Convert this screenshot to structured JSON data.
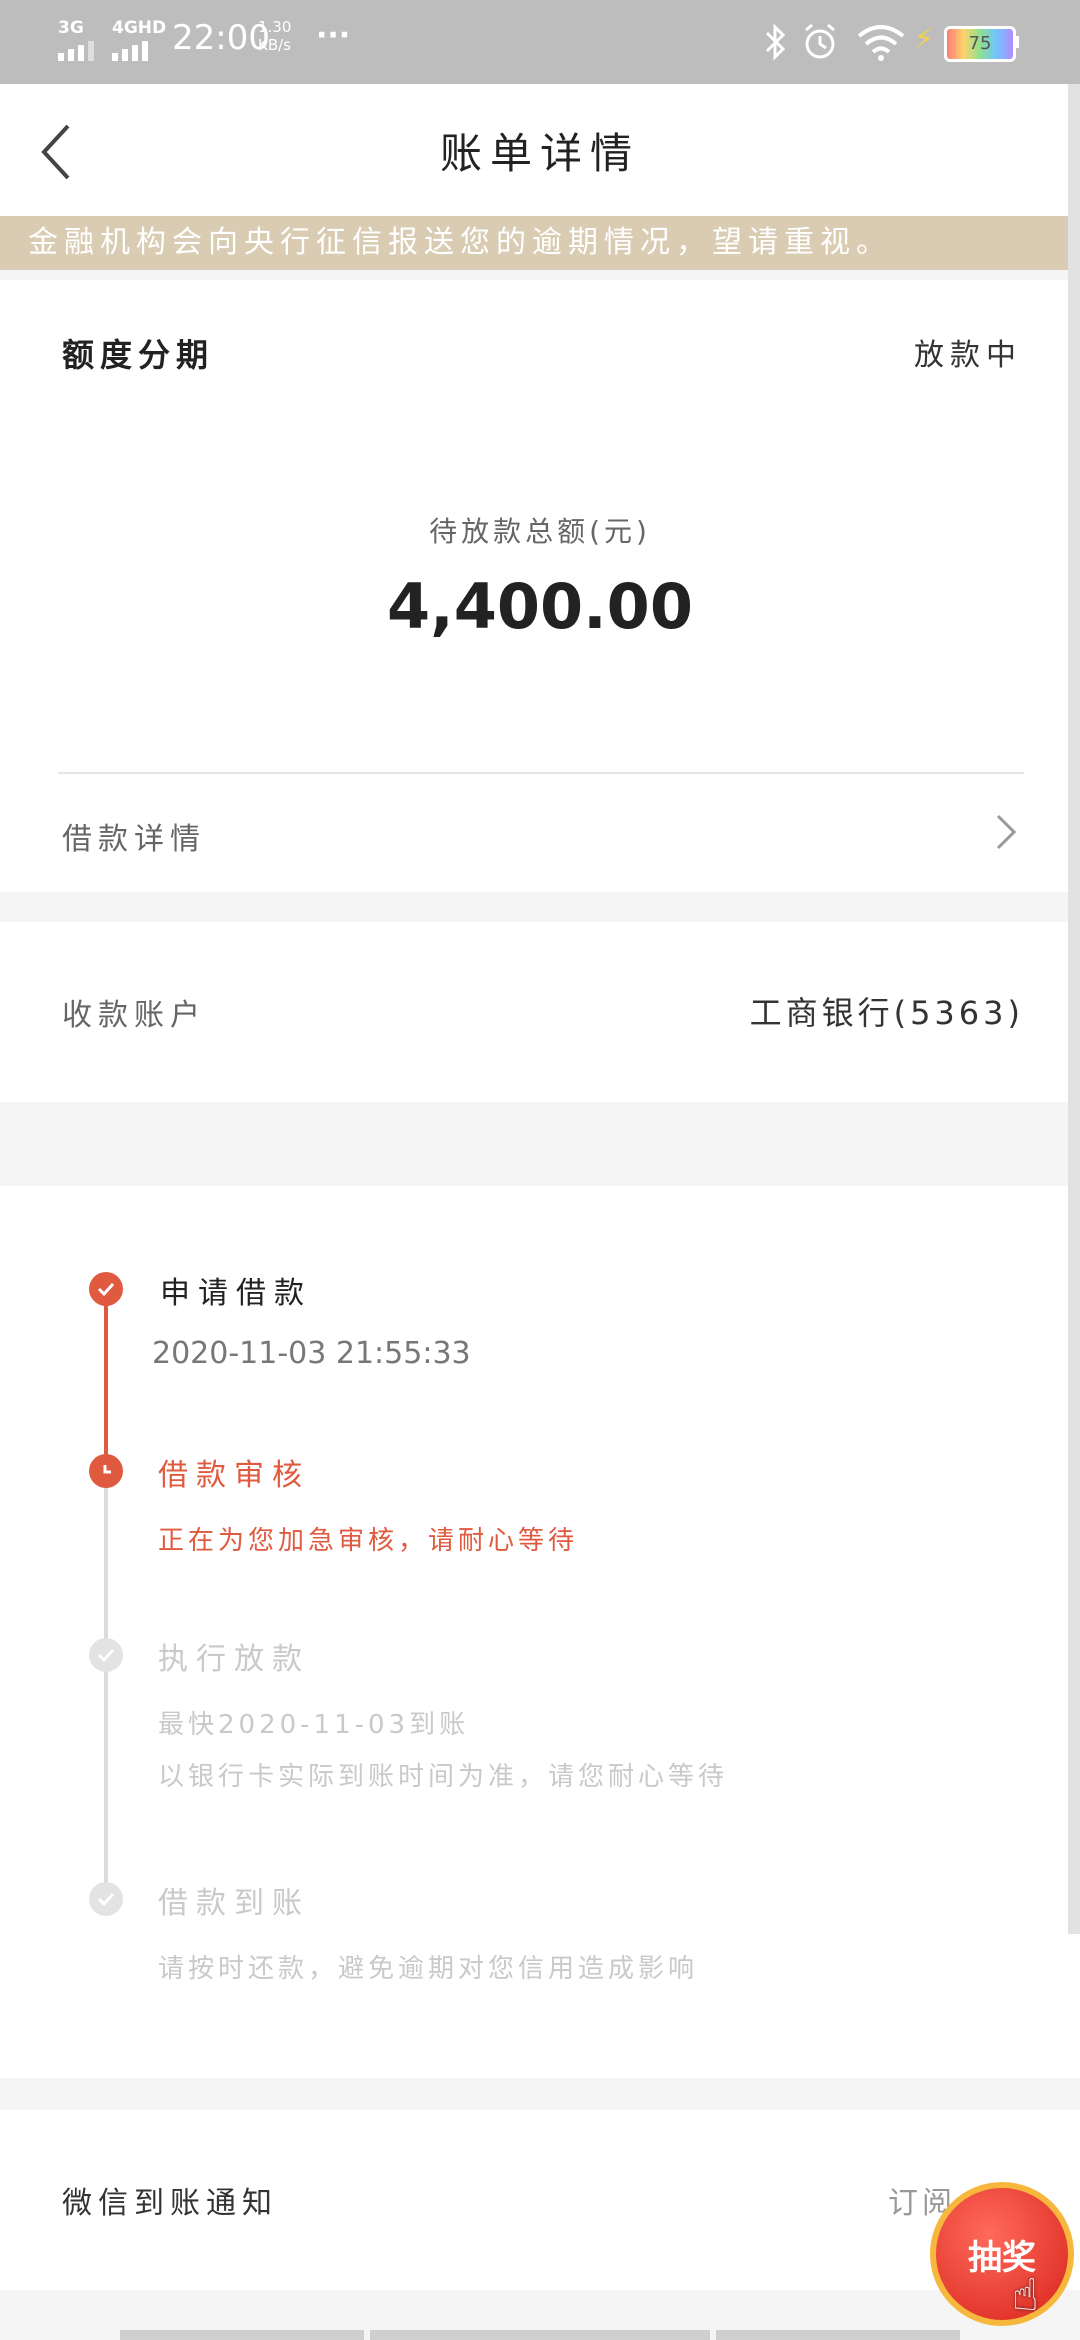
{
  "status_bar": {
    "network1": "3G",
    "network2": "4GHD",
    "time": "22:00",
    "speed_value": "1.30",
    "speed_unit": "KB/s",
    "more": "···",
    "battery": "75",
    "icons": [
      "signal-icon",
      "bluetooth-icon",
      "alarm-icon",
      "wifi-icon",
      "charging-icon",
      "battery-icon"
    ]
  },
  "header": {
    "title": "账单详情",
    "back_icon": "chevron-left-icon"
  },
  "banner": {
    "text": "金融机构会向央行征信报送您的逾期情况，望请重视。"
  },
  "summary": {
    "type": "额度分期",
    "status": "放款中",
    "amount_label": "待放款总额(元)",
    "amount": "4,400.00"
  },
  "loan_details": {
    "label": "借款详情",
    "icon": "chevron-right-icon"
  },
  "account": {
    "label": "收款账户",
    "value": "工商银行(5363)"
  },
  "timeline": {
    "steps": [
      {
        "title": "申请借款",
        "subtitle": "2020-11-03 21:55:33",
        "state": "done"
      },
      {
        "title": "借款审核",
        "subtitle": "正在为您加急审核，请耐心等待",
        "state": "current"
      },
      {
        "title": "执行放款",
        "subtitle": "最快2020-11-03到账",
        "subtitle2": "以银行卡实际到账时间为准，请您耐心等待",
        "state": "pending"
      },
      {
        "title": "借款到账",
        "subtitle": "请按时还款，避免逾期对您信用造成影响",
        "state": "pending"
      }
    ]
  },
  "wechat": {
    "label": "微信到账通知",
    "action": "订阅"
  },
  "lottery": {
    "label": "抽奖",
    "icon": "hand-pointer-icon"
  },
  "colors": {
    "accent": "#e05a3f",
    "banner": "#d9ccb3",
    "statusbar": "#bdbdbd"
  }
}
